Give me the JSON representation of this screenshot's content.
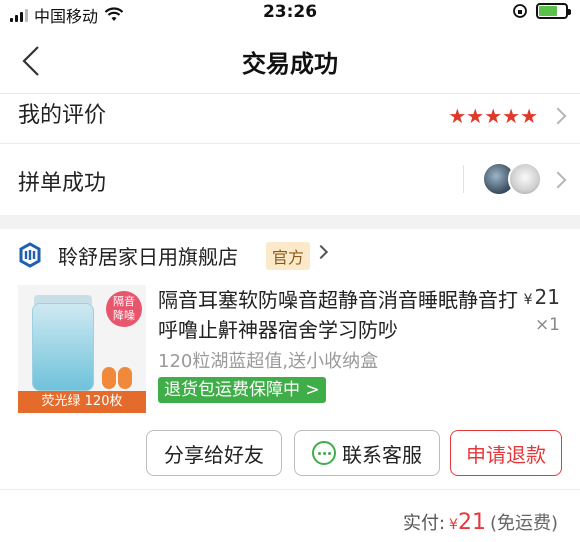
{
  "status": {
    "carrier": "中国移动",
    "time": "23:26"
  },
  "nav": {
    "title": "交易成功"
  },
  "review": {
    "label": "我的评价",
    "stars": "★★★★★",
    "star_count": 5
  },
  "group": {
    "label": "拼单成功"
  },
  "store": {
    "name": "聆舒居家日用旗舰店",
    "badge": "官方"
  },
  "product": {
    "title": "隔音耳塞软防噪音超静音消音睡眠静音打呼噜止鼾神器宿舍学习防吵",
    "currency": "¥",
    "price": "21",
    "qty": "×1",
    "spec": "120粒湖蓝超值,送小收纳盒",
    "guarantee": "退货包运费保障中",
    "image": {
      "badge": "隔音\n降噪",
      "caption": "荧光绿 120枚"
    }
  },
  "actions": {
    "share": "分享给好友",
    "service": "联系客服",
    "refund": "申请退款"
  },
  "total": {
    "label": "实付:",
    "currency": "¥",
    "amount": "21",
    "note": "(免运费)"
  },
  "colors": {
    "accent": "#e4393c",
    "guarantee": "#3fae49",
    "badge_bg": "#fbe9c9"
  }
}
